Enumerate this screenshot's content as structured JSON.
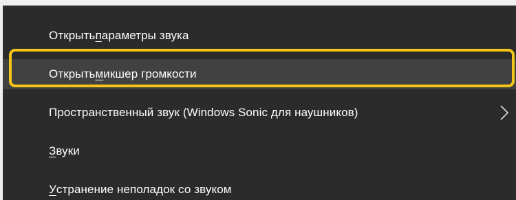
{
  "menu": {
    "items": [
      {
        "pre": "Открыть ",
        "key": "п",
        "post": "араметры звука"
      },
      {
        "pre": "Открыть ",
        "key": "м",
        "post": "икшер громкости"
      },
      {
        "pre": "Пространственный звук (Windows Sonic для наушников)",
        "key": "",
        "post": ""
      },
      {
        "pre": "",
        "key": "З",
        "post": "вуки"
      },
      {
        "pre": "",
        "key": "У",
        "post": "странение неполадок со звуком"
      }
    ]
  },
  "icons": {
    "submenu": "chevron-right-icon"
  },
  "colors": {
    "menu_background": "#2b2b2b",
    "hover_background": "#414141",
    "highlight_ring": "#f5c518",
    "text": "#ffffff"
  }
}
